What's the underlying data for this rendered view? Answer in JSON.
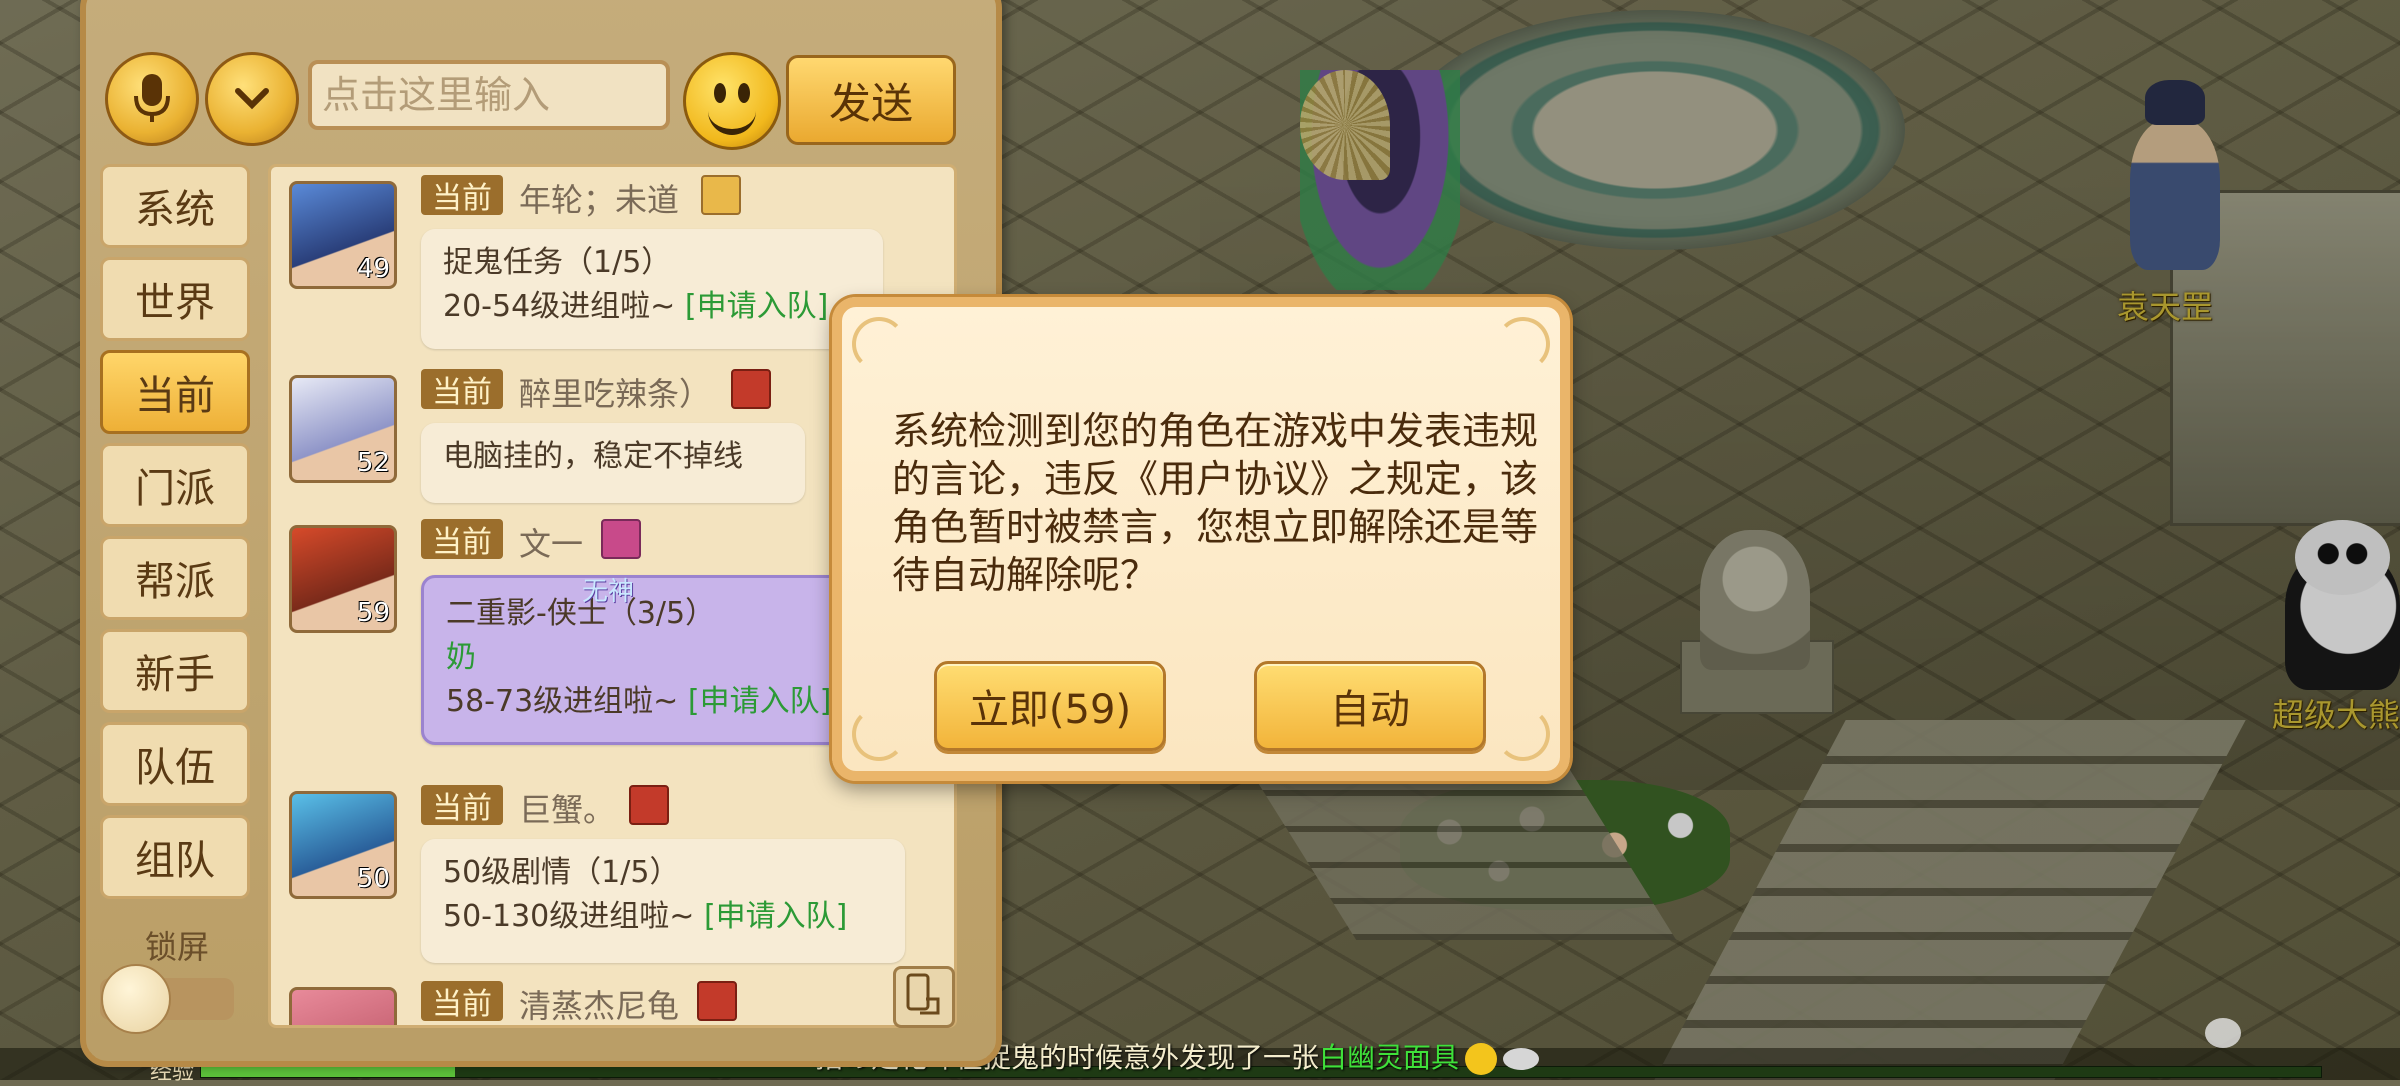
{
  "chat": {
    "input_placeholder": "点击这里输入",
    "send_label": "发送",
    "tabs": [
      "系统",
      "世界",
      "当前",
      "门派",
      "帮派",
      "新手",
      "队伍",
      "组队"
    ],
    "active_tab": "当前",
    "lock_label": "锁屏",
    "messages": [
      {
        "channel": "当前",
        "sender": "年轮；未道",
        "level": "49",
        "line1": "捉鬼任务（1/5）",
        "line2": "20-54级进组啦~",
        "link": "[申请入队]"
      },
      {
        "channel": "当前",
        "sender": "醉里吃辣条）",
        "level": "52",
        "line1": "电脑挂的，稳定不掉线"
      },
      {
        "channel": "当前",
        "sender": "文一",
        "level": "59",
        "tag": "无神",
        "line1": "二重影-侠士（3/5）",
        "line2": "奶",
        "line3": "58-73级进组啦~",
        "link": "[申请入队]"
      },
      {
        "channel": "当前",
        "sender": "巨蟹。",
        "level": "50",
        "line1": "50级剧情（1/5）",
        "line2": "50-130级进组啦~",
        "link": "[申请入队]"
      },
      {
        "channel": "当前",
        "sender": "清蒸杰尼龟"
      }
    ]
  },
  "dialog": {
    "message": "系统检测到您的角色在游戏中发表违规的言论，违反《用户协议》之规定，该角色暂时被禁言，您想立即解除还是等待自动解除呢？",
    "immediate_label": "立即(59)",
    "auto_label": "自动"
  },
  "scene": {
    "npc_names": [
      "袁天罡",
      "超级大熊"
    ],
    "exp_label": "经验",
    "marquee_prefix": "指の定乾坤在捉鬼的时候意外发现了一张",
    "marquee_item": "白幽灵面具"
  },
  "colors": {
    "panel": "#e6c990",
    "accent_gold": "#eab232",
    "link_green": "#2c9a36",
    "npc_name": "#d9c23b"
  }
}
